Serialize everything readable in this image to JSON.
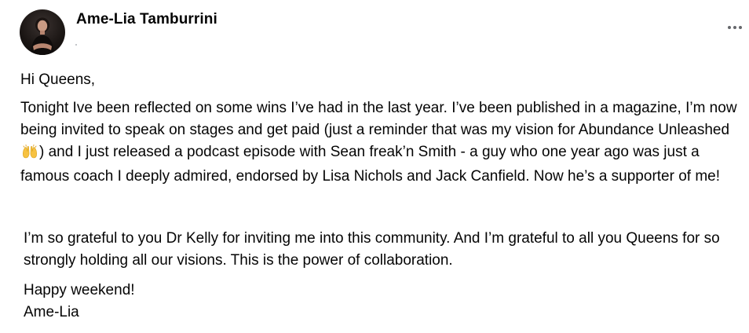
{
  "post": {
    "author_name": "Ame-Lia Tamburrini",
    "icons": {
      "avatar": "profile-photo",
      "more": "more-options-icon",
      "emoji": "raising-hands-emoji"
    },
    "body": {
      "greeting": "Hi Queens,",
      "main_before_emoji": "Tonight Ive been reflected on some wins I’ve had in the last year. I’ve been published in a magazine, I’m now being invited to speak on stages and get paid (just a reminder that was my vision for Abundance Unleashed ",
      "main_after_emoji": ") and I just released a podcast episode with Sean freak’n Smith - a guy who one year ago was just a famous coach I deeply admired, endorsed by Lisa Nichols and Jack Canfield. Now he’s a supporter of me!",
      "grateful": "I’m so grateful to you Dr Kelly for inviting me into this community. And I’m grateful to all you Queens for so strongly holding all our visions. This is the power of collaboration.",
      "signoff_line1": "Happy weekend!",
      "signoff_line2": "Ame-Lia"
    }
  }
}
